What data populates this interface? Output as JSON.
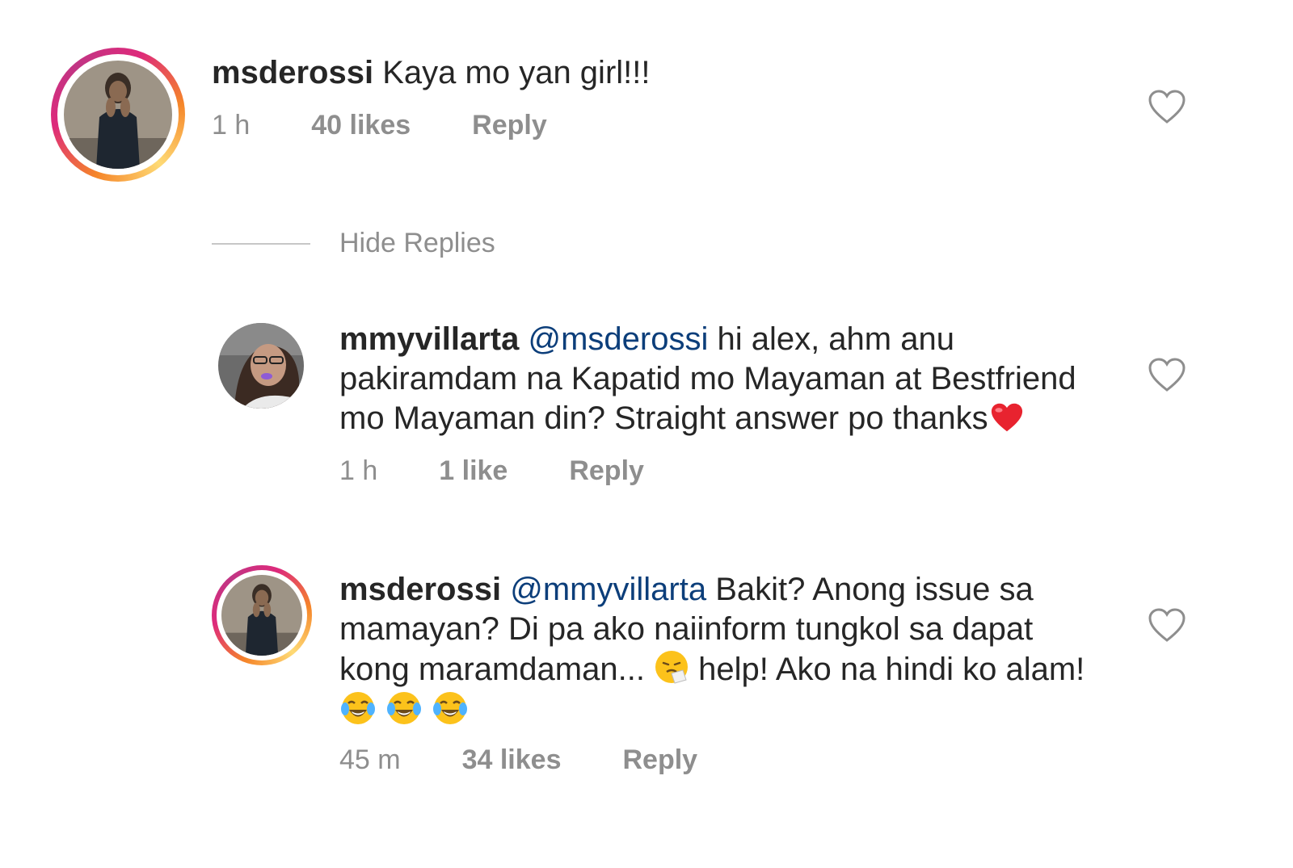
{
  "comments": [
    {
      "username": "msderossi",
      "mention": "",
      "text": "Kaya mo yan girl!!!",
      "time": "1 h",
      "likes": "40 likes",
      "reply": "Reply"
    },
    {
      "username": "mmyvillarta",
      "mention": "@msderossi",
      "text_line1": " hi alex, ahm anu",
      "text_line2": "pakiramdam na Kapatid mo Mayaman at Bestfriend",
      "text_line3": "mo Mayaman din? Straight answer po thanks",
      "time": "1 h",
      "likes": "1 like",
      "reply": "Reply"
    },
    {
      "username": "msderossi",
      "mention": "@mmyvillarta",
      "text_line1": " Bakit? Anong issue sa",
      "text_line2": "mamayan? Di pa ako naiinform tungkol sa dapat",
      "text_line3a": "kong maramdaman... ",
      "text_line3b": " help! Ako na hindi ko alam!",
      "time": "45 m",
      "likes": "34 likes",
      "reply": "Reply"
    }
  ],
  "hide_replies": "Hide Replies",
  "colors": {
    "text": "#262626",
    "meta": "#8e8e8e",
    "mention": "#0c3e7a"
  },
  "icons": [
    "heart-outline-icon",
    "red-heart-emoji",
    "sneezing-face-emoji",
    "tears-of-joy-emoji"
  ]
}
